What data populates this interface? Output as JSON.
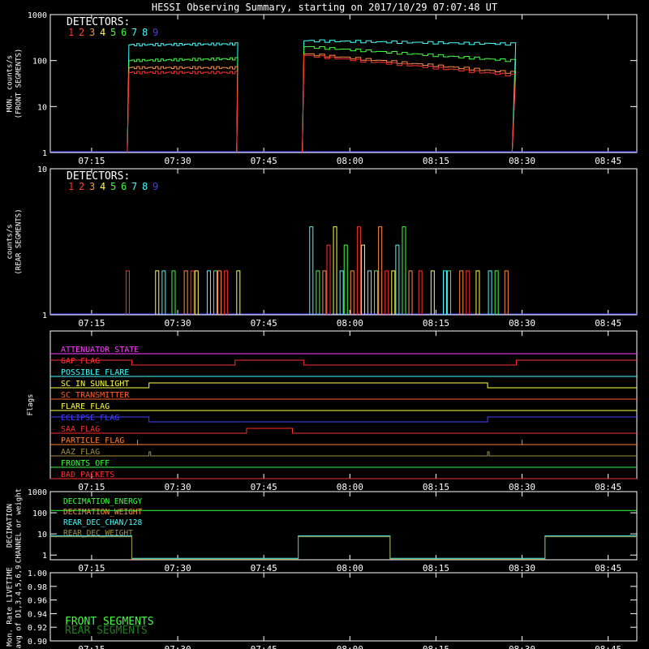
{
  "title": "HESSI Observing Summary, starting on 2017/10/29 07:07:48 UT",
  "time_ticks": [
    "07:15",
    "07:30",
    "07:45",
    "08:00",
    "08:15",
    "08:30",
    "08:45"
  ],
  "time_range": [
    "07:07:48",
    "08:50"
  ],
  "detector_colors": [
    "#ff3030",
    "#ff4040",
    "#ff9040",
    "#ffff40",
    "#40ff40",
    "#40ff40",
    "#40ffff",
    "#40ffff",
    "#4040ff"
  ],
  "chart_data": [
    {
      "type": "line",
      "panel": "front",
      "ylabel": "MON. counts/s\n(FRONT SEGMENTS)",
      "yscale": "log",
      "ylim": [
        1,
        1000
      ],
      "yticks": [
        "1",
        "10",
        "100",
        "1000"
      ],
      "legend_title": "DETECTORS:",
      "legend_numbers": [
        "1",
        "2",
        "3",
        "4",
        "5",
        "6",
        "7",
        "8",
        "9"
      ],
      "series": [
        {
          "color": "#40ffff",
          "x": [
            "07:21",
            "07:21:30",
            "07:40",
            "07:52",
            "08:28"
          ],
          "values": [
            1,
            220,
            230,
            270,
            230
          ]
        },
        {
          "color": "#40ff40",
          "x": [
            "07:21",
            "07:21:30",
            "07:40",
            "07:52",
            "08:00",
            "08:28"
          ],
          "values": [
            1,
            100,
            110,
            200,
            190,
            100
          ]
        },
        {
          "color": "#ff9040",
          "x": [
            "07:21",
            "07:21:30",
            "07:40",
            "07:52",
            "08:00",
            "08:28"
          ],
          "values": [
            1,
            70,
            70,
            140,
            130,
            55
          ]
        },
        {
          "color": "#ff3030",
          "x": [
            "07:21",
            "07:21:30",
            "07:40",
            "07:52",
            "08:00",
            "08:28"
          ],
          "values": [
            1,
            55,
            55,
            130,
            120,
            48
          ]
        }
      ]
    },
    {
      "type": "bar",
      "panel": "rear",
      "ylabel": "counts/s\n(REAR SEGMENTS)",
      "yscale": "log",
      "ylim": [
        1,
        10
      ],
      "yticks": [
        "1",
        "10"
      ],
      "legend_title": "DETECTORS:",
      "legend_numbers": [
        "1",
        "2",
        "3",
        "4",
        "5",
        "6",
        "7",
        "8",
        "9"
      ]
    },
    {
      "type": "line",
      "panel": "flags",
      "ylabel": "Flags",
      "flags": [
        {
          "label": "ATTENUATOR_STATE",
          "color": "#ff40ff"
        },
        {
          "label": "GAP_FLAG",
          "color": "#ff3030"
        },
        {
          "label": "POSSIBLE_FLARE",
          "color": "#40ffff"
        },
        {
          "label": "SC_IN_SUNLIGHT",
          "color": "#ffff40"
        },
        {
          "label": "SC_TRANSMITTER",
          "color": "#ff6030"
        },
        {
          "label": "FLARE_FLAG",
          "color": "#ffff40"
        },
        {
          "label": "ECLIPSE_FLAG",
          "color": "#4040ff"
        },
        {
          "label": "SAA_FLAG",
          "color": "#ff3030"
        },
        {
          "label": "PARTICLE_FLAG",
          "color": "#ff8030"
        },
        {
          "label": "AAZ_FLAG",
          "color": "#a09040"
        },
        {
          "label": "FRONTS_OFF",
          "color": "#40ff40"
        },
        {
          "label": "BAD_PACKETS",
          "color": "#ff3030"
        }
      ]
    },
    {
      "type": "line",
      "panel": "decimation",
      "ylabel": "DECIMATION\nCHANNEL or weight",
      "yscale": "log",
      "yticks": [
        "1",
        "10",
        "100",
        "1000"
      ],
      "legend": [
        {
          "label": "DECIMATION_ENERGY",
          "color": "#40ff40"
        },
        {
          "label": "DECIMATION_WEIGHT",
          "color": "#ff9040"
        },
        {
          "label": "REAR_DEC_CHAN/128",
          "color": "#40ffff"
        },
        {
          "label": "REAR_DEC_WEIGHT",
          "color": "#a09040"
        }
      ]
    },
    {
      "type": "line",
      "panel": "livetime",
      "ylabel": "Mon. Rate LIVETIME\navg of D1,3,4,5,6,9",
      "ylim": [
        0.9,
        1.0
      ],
      "yticks": [
        "0.90",
        "0.92",
        "0.94",
        "0.96",
        "0.98",
        "1.00"
      ],
      "legend": [
        {
          "label": "FRONT SEGMENTS",
          "color": "#40ff40"
        },
        {
          "label": "REAR SEGMENTS",
          "color": "#208020"
        }
      ]
    }
  ]
}
